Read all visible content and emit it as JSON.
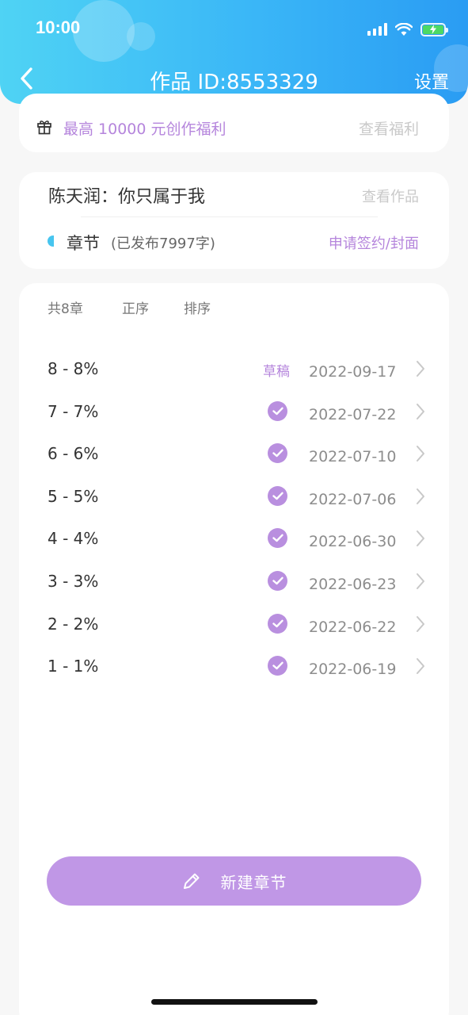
{
  "status_bar": {
    "time": "10:00",
    "icons": [
      "signal-icon",
      "wifi-icon",
      "battery-charging-icon"
    ]
  },
  "nav": {
    "back_icon": "chevron-left-icon",
    "title": "作品 ID:8553329",
    "settings_label": "设置"
  },
  "welfare": {
    "icon": "gift-icon",
    "text": "最高 10000 元创作福利",
    "link": "查看福利"
  },
  "work": {
    "title": "陈天润：你只属于我",
    "view_link": "查看作品",
    "chapter_label": "章节",
    "chapter_count": "(已发布7997字)",
    "sign_link": "申请签约/封面"
  },
  "chapter_list": {
    "total": "共8章",
    "order_asc": "正序",
    "order_sort": "排序",
    "rows": [
      {
        "title": "8 - 8%",
        "status": "草稿",
        "date": "2022-09-17"
      },
      {
        "title": "7 - 7%",
        "status": "published",
        "date": "2022-07-22"
      },
      {
        "title": "6 - 6%",
        "status": "published",
        "date": "2022-07-10"
      },
      {
        "title": "5 - 5%",
        "status": "published",
        "date": "2022-07-06"
      },
      {
        "title": "4 - 4%",
        "status": "published",
        "date": "2022-06-30"
      },
      {
        "title": "3 - 3%",
        "status": "published",
        "date": "2022-06-23"
      },
      {
        "title": "2 - 2%",
        "status": "published",
        "date": "2022-06-22"
      },
      {
        "title": "1 - 1%",
        "status": "published",
        "date": "2022-06-19"
      }
    ]
  },
  "new_chapter": {
    "icon": "pencil-icon",
    "label": "新建章节"
  },
  "colors": {
    "header_gradient_start": "#4fd3f4",
    "header_gradient_end": "#2a9cf3",
    "accent_purple": "#b585dc",
    "button_purple": "#c097e6",
    "chapter_dot": "#47c5ef"
  }
}
